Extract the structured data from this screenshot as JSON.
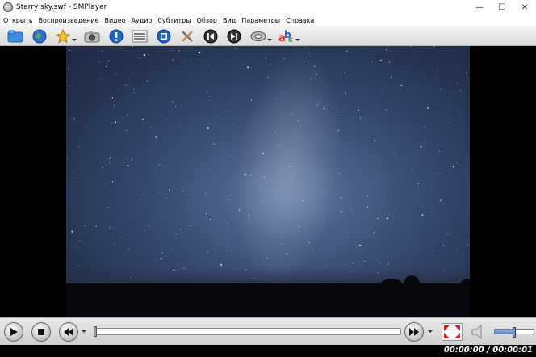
{
  "window": {
    "title": "Starry sky.swf - SMPlayer",
    "minimize_glyph": "—",
    "maximize_glyph": "☐",
    "close_glyph": "✕"
  },
  "menu": {
    "items": [
      "Открыть",
      "Воспроизведение",
      "Видео",
      "Аудио",
      "Субтитры",
      "Обзор",
      "Вид",
      "Параметры",
      "Справка"
    ]
  },
  "toolbar": {
    "icons": [
      "open-folder-icon",
      "web-globe-icon",
      "favorites-star-icon",
      "screenshot-camera-icon",
      "info-icon",
      "playlist-icon",
      "media-info-icon",
      "preferences-tools-icon",
      "previous-icon",
      "next-icon",
      "audio-track-icon",
      "subtitles-icon"
    ]
  },
  "video": {
    "content": "starry night sky"
  },
  "controls": {
    "play_icon": "play-icon",
    "stop_icon": "stop-icon",
    "rewind_icon": "rewind-icon",
    "forward_icon": "forward-icon",
    "fullscreen_icon": "fullscreen-icon",
    "speaker_icon": "speaker-icon",
    "seek_progress": 0.0,
    "volume_level": 0.5
  },
  "status": {
    "time": "00:00:00 / 00:00:01"
  },
  "colors": {
    "accent": "#5a86c8",
    "sky": "#4a5d84"
  }
}
